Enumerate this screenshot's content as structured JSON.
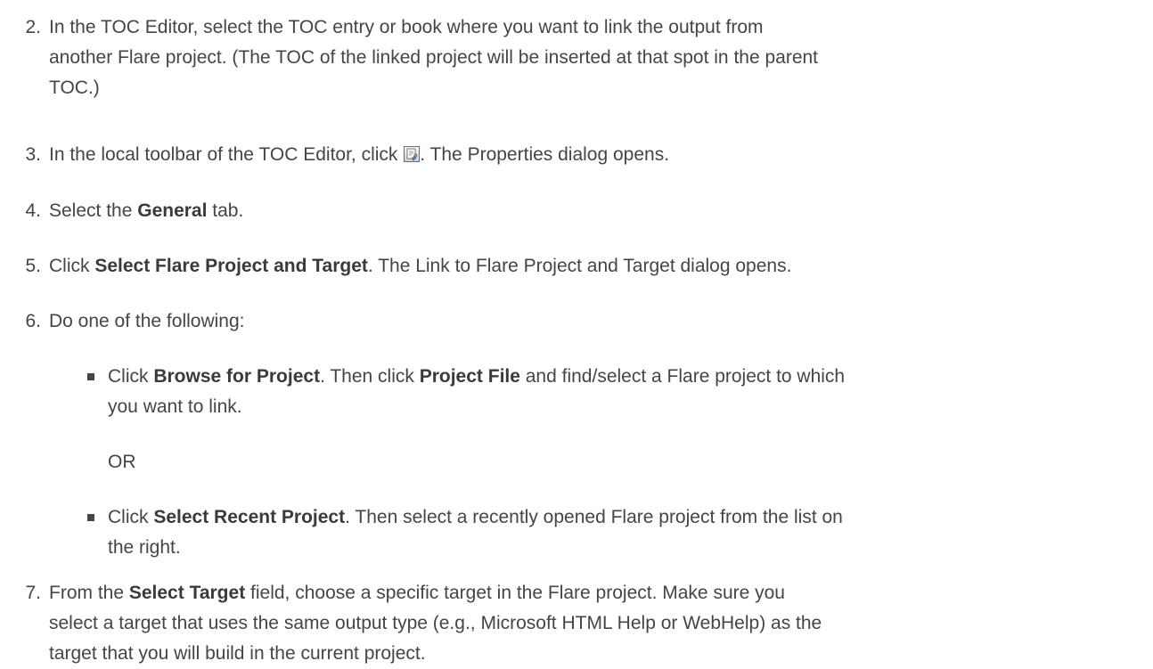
{
  "steps": {
    "s2": {
      "num": "2.",
      "line1": "In the TOC Editor, select the TOC entry or book where you want to link the output from",
      "line2": "another Flare project. (The TOC of the linked project will be inserted at that spot in the parent",
      "line3": "TOC.)"
    },
    "s3": {
      "num": "3.",
      "before": "In the local toolbar of the TOC Editor, click ",
      "icon": "properties-icon",
      "after": ". The Properties dialog opens."
    },
    "s4": {
      "num": "4.",
      "before": "Select the ",
      "bold": "General",
      "after": " tab."
    },
    "s5": {
      "num": "5.",
      "before": "Click ",
      "bold": "Select Flare Project and Target",
      "after": ". The Link to Flare Project and Target dialog opens."
    },
    "s6": {
      "num": "6.",
      "text": "Do one of the following:",
      "option1": {
        "before": "Click ",
        "bold1": "Browse for Project",
        "mid": ". Then click ",
        "bold2": "Project File",
        "after": " and find/select a Flare project to which",
        "line2": "you want to link."
      },
      "or": "OR",
      "option2": {
        "before": "Click ",
        "bold1": "Select Recent Project",
        "after": ". Then select a recently opened Flare project from the list on",
        "line2": "the right."
      }
    },
    "s7": {
      "num": "7.",
      "before": "From the ",
      "bold": "Select Target",
      "after": " field, choose a specific target in the Flare project. Make sure you",
      "line2": "select a target that uses the same output type (e.g., Microsoft HTML Help or WebHelp) as the",
      "line3": "target that you will build in the current project."
    }
  }
}
